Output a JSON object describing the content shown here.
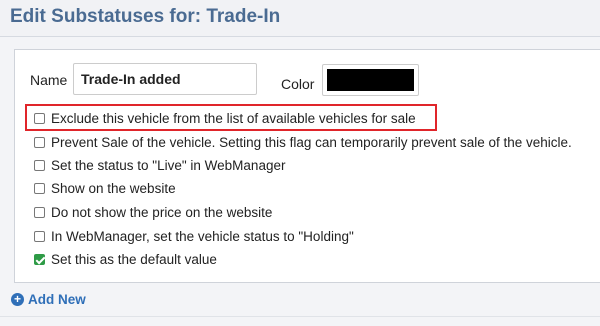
{
  "header": {
    "title": "Edit Substatuses for: Trade-In"
  },
  "form": {
    "name_label": "Name",
    "name_value": "Trade-In added",
    "color_label": "Color",
    "color_value": "#000000"
  },
  "options": [
    {
      "label": "Exclude this vehicle from the list of available vehicles for sale",
      "checked": false,
      "highlighted": true
    },
    {
      "label": "Prevent Sale of the vehicle. Setting this flag can temporarily prevent sale of the vehicle.",
      "checked": false
    },
    {
      "label": "Set the status to \"Live\" in WebManager",
      "checked": false
    },
    {
      "label": "Show on the website",
      "checked": false
    },
    {
      "label": "Do not show the price on the website",
      "checked": false
    },
    {
      "label": "In WebManager, set the vehicle status to \"Holding\"",
      "checked": false
    },
    {
      "label": "Set this as the default value",
      "checked": true
    }
  ],
  "actions": {
    "add_new_label": "Add New",
    "add_new_icon": "plus-circle-icon"
  },
  "colors": {
    "title": "#4a6b92",
    "highlight": "#e0252a",
    "checked": "#2e9b46",
    "link": "#2f6fb8"
  }
}
